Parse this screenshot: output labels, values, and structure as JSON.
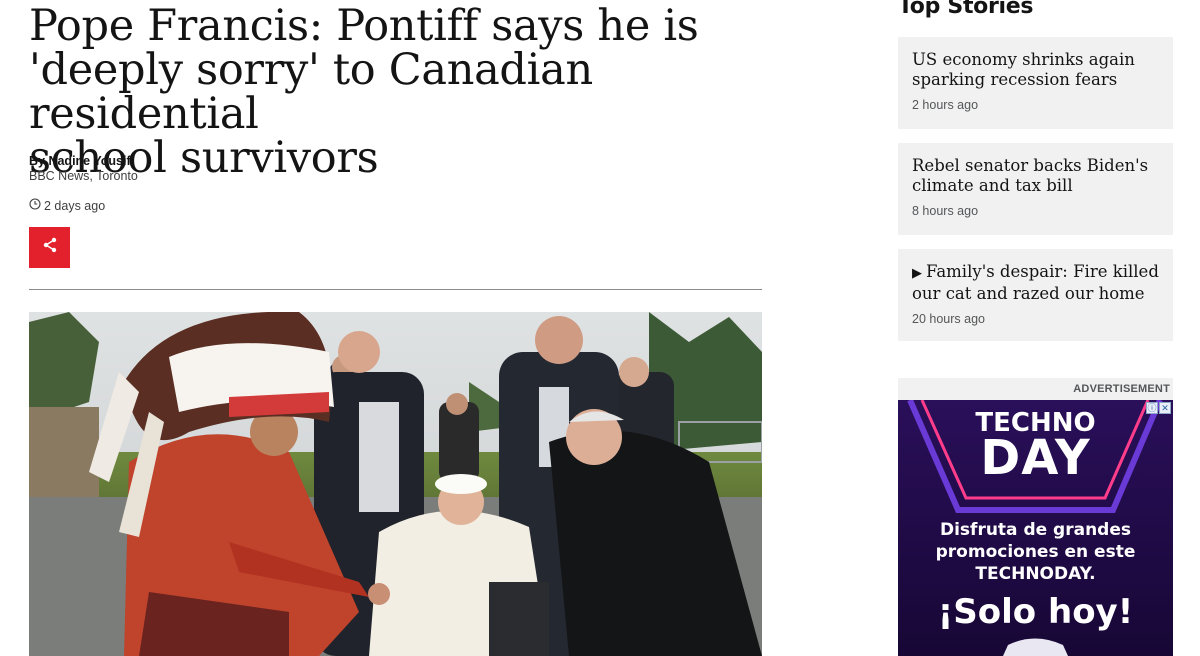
{
  "article": {
    "headline_lines": [
      "Pope Francis: Pontiff says he is",
      "'deeply sorry' to Canadian residential",
      "school survivors"
    ],
    "author": "By Nadine Yousif",
    "organisation": "BBC News, Toronto",
    "timestamp": "2 days ago",
    "share_icon": "share-icon",
    "clock_icon": "clock-icon"
  },
  "sidebar": {
    "title": "Top Stories",
    "stories": [
      {
        "title": "US economy shrinks again sparking recession fears",
        "time": "2 hours ago",
        "has_play": false
      },
      {
        "title": "Rebel senator backs Biden's climate and tax bill",
        "time": "8 hours ago",
        "has_play": false
      },
      {
        "title": "Family's despair: Fire killed our cat and razed our home",
        "time": "20 hours ago",
        "has_play": true,
        "play_glyph": "▶"
      }
    ]
  },
  "advertisement": {
    "label": "ADVERTISEMENT",
    "brand_line1": "TECHNO",
    "brand_line2": "DAY",
    "copy_line1": "Disfruta de grandes",
    "copy_line2": "promociones en este",
    "copy_line3": "TECHNODAY.",
    "cta": "¡Solo hoy!",
    "adchoices_i": "ⓘ",
    "adchoices_x": "✕"
  },
  "colors": {
    "share_red": "#e3212c",
    "card_bg": "#f1f1f1",
    "ad_bg": "#1b0a3e",
    "ad_accent": "#ff3d8b"
  }
}
